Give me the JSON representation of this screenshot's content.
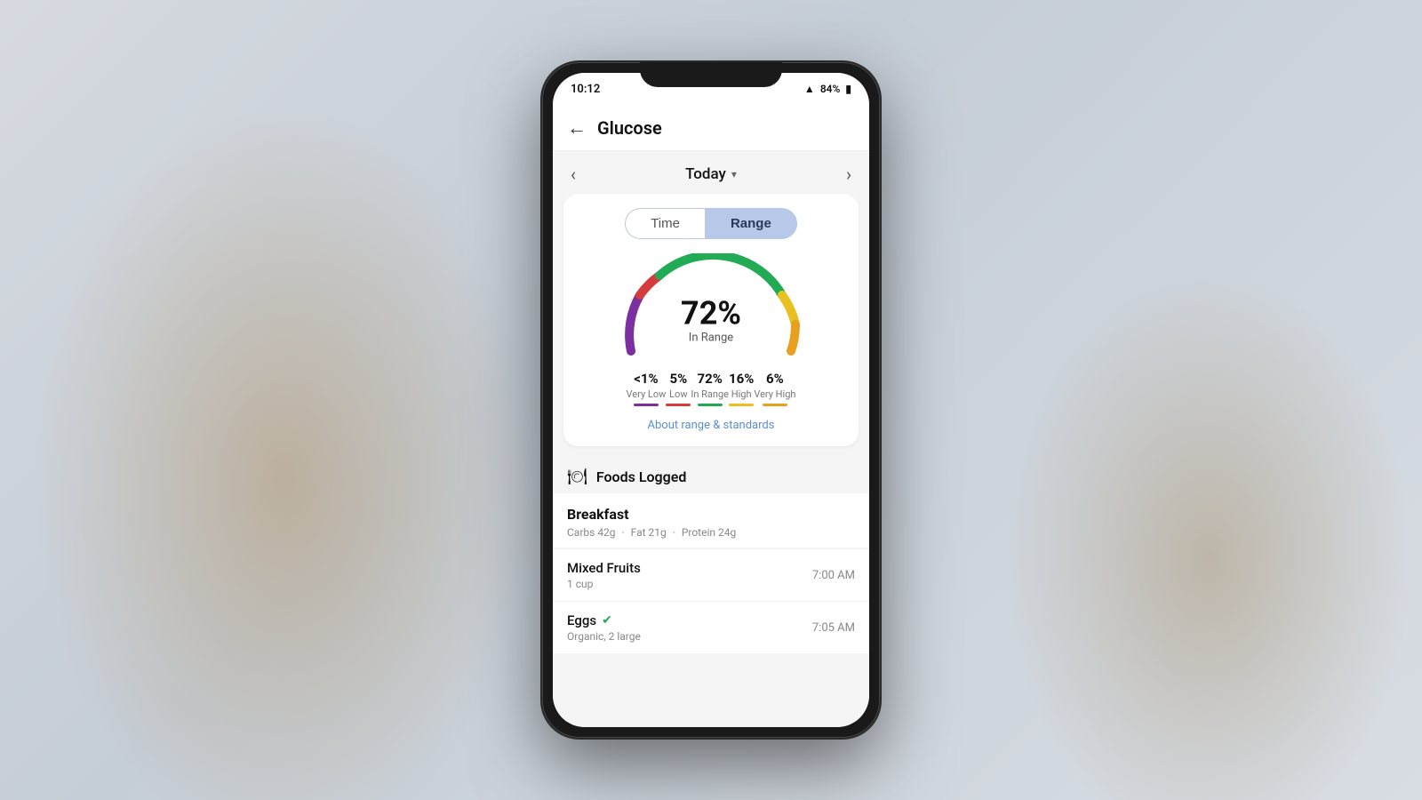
{
  "phone": {
    "status_bar": {
      "time": "10:12",
      "signal": "▲84%",
      "battery": "🔋"
    },
    "header": {
      "back_label": "←",
      "title": "Glucose"
    },
    "date_nav": {
      "prev_arrow": "‹",
      "next_arrow": "›",
      "current_label": "Today",
      "dropdown_arrow": "▾"
    },
    "range_card": {
      "toggle_time": "Time",
      "toggle_range": "Range",
      "active_toggle": "Range",
      "gauge_percent": "72%",
      "gauge_sublabel": "In Range",
      "stats": [
        {
          "value": "<1%",
          "name": "Very Low",
          "color": "#7b2fa0"
        },
        {
          "value": "5%",
          "name": "Low",
          "color": "#d63a3a"
        },
        {
          "value": "72%",
          "name": "In Range",
          "color": "#22aa55"
        },
        {
          "value": "16%",
          "name": "High",
          "color": "#e8c020"
        },
        {
          "value": "6%",
          "name": "Very High",
          "color": "#e8a020"
        }
      ],
      "about_link": "About range & standards"
    },
    "foods_section": {
      "icon": "🍽",
      "title": "Foods Logged",
      "meal_groups": [
        {
          "meal_name": "Breakfast",
          "macros": "Carbs 42g  ·  Fat 21g  ·  Protein 24g",
          "items": [
            {
              "name": "Mixed Fruits",
              "serving": "1 cup",
              "time": "7:00 AM",
              "verified": false
            },
            {
              "name": "Eggs",
              "serving": "Organic, 2 large",
              "time": "7:05 AM",
              "verified": true
            }
          ]
        }
      ]
    }
  }
}
